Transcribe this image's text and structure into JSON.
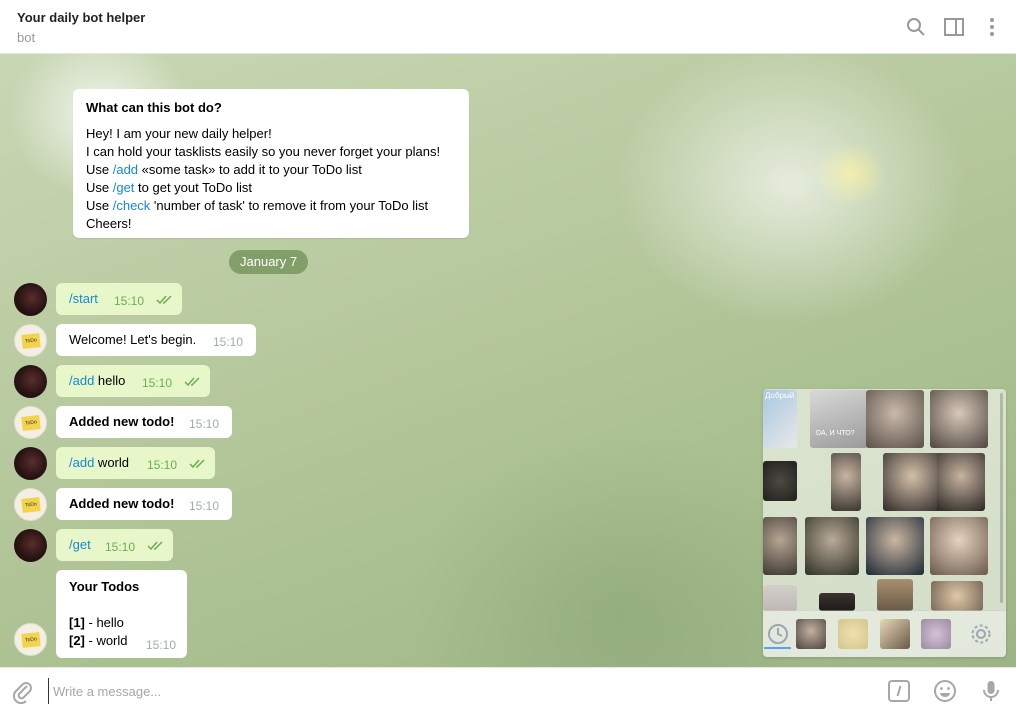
{
  "header": {
    "title": "Your daily bot helper",
    "subtitle": "bot",
    "icons": [
      "search-icon",
      "sidebar-toggle-icon",
      "more-vertical-icon"
    ]
  },
  "bot_info": {
    "title": "What can this bot do?",
    "line1": "Hey! I am your new daily helper!",
    "line2": "I can hold your tasklists easily so you never forget your plans!",
    "line3_prefix": "Use ",
    "line3_cmd": "/add",
    "line3_rest": " «some task» to add it to your ToDo list",
    "line4_prefix": "Use ",
    "line4_cmd": "/get",
    "line4_rest": " to get yout ToDo list",
    "line5_prefix": "Use ",
    "line5_cmd": "/check",
    "line5_rest": " 'number of task' to remove it from your ToDo list",
    "line6": "Cheers!"
  },
  "date_separator": "January 7",
  "messages": [
    {
      "from": "user",
      "cmd": "/start",
      "text": "",
      "time": "15:10"
    },
    {
      "from": "bot",
      "text": "Welcome! Let's begin.",
      "time": "15:10"
    },
    {
      "from": "user",
      "cmd": "/add",
      "text": " hello",
      "time": "15:10"
    },
    {
      "from": "bot",
      "text": "Added new todo!",
      "time": "15:10"
    },
    {
      "from": "user",
      "cmd": "/add",
      "text": " world",
      "time": "15:10"
    },
    {
      "from": "bot",
      "text": "Added new todo!",
      "time": "15:10"
    },
    {
      "from": "user",
      "cmd": "/get",
      "text": "",
      "time": "15:10"
    }
  ],
  "todos_message": {
    "title": "Your Todos",
    "items": [
      {
        "num": "[1]",
        "text": " - hello"
      },
      {
        "num": "[2]",
        "text": " - world"
      }
    ],
    "time": "15:10"
  },
  "sticker_panel": {
    "sticker_caption_1": "Добрый",
    "sticker_caption_2": "DA, И ЧТО?"
  },
  "composer": {
    "placeholder": "Write a message..."
  },
  "colors": {
    "accent": "#168acd",
    "outgoing_bubble": "#e7f7c9",
    "outgoing_time": "#6cad52",
    "date_pill": "#7a965f"
  }
}
